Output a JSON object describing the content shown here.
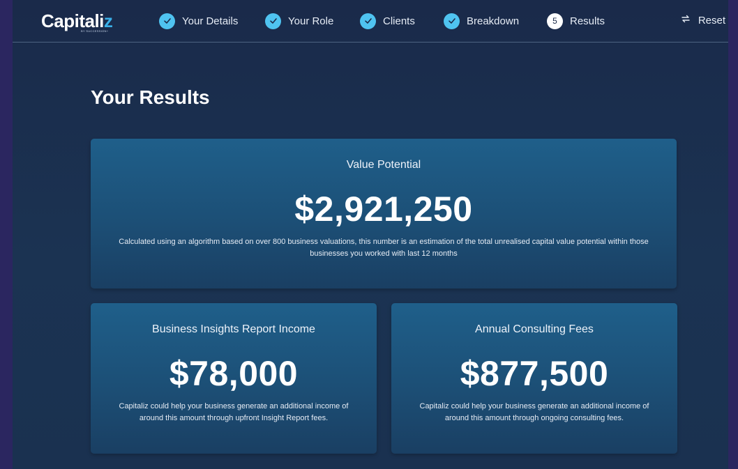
{
  "brand": {
    "name_main": "Capitali",
    "name_accent": "z",
    "tagline": "BY SUCCESSION+"
  },
  "steps": [
    {
      "label": "Your Details",
      "status": "complete",
      "icon": "check-icon"
    },
    {
      "label": "Your Role",
      "status": "complete",
      "icon": "check-icon"
    },
    {
      "label": "Clients",
      "status": "complete",
      "icon": "check-icon"
    },
    {
      "label": "Breakdown",
      "status": "complete",
      "icon": "check-icon"
    },
    {
      "label": "Results",
      "status": "current",
      "number": "5"
    }
  ],
  "reset": {
    "label": "Reset",
    "icon": "reset-icon"
  },
  "page": {
    "title": "Your Results"
  },
  "cards": {
    "value_potential": {
      "title": "Value Potential",
      "value": "$2,921,250",
      "description": "Calculated using an algorithm based on over 800 business valuations, this number is an estimation of the total unrealised capital value potential within those businesses you worked with last 12 months"
    },
    "insights_income": {
      "title": "Business Insights Report Income",
      "value": "$78,000",
      "description": "Capitaliz could help your business generate an additional income of around this amount through upfront Insight Report fees."
    },
    "consulting_fees": {
      "title": "Annual Consulting Fees",
      "value": "$877,500",
      "description": "Capitaliz could help your business generate an additional income of around this amount through ongoing consulting fees."
    }
  },
  "colors": {
    "background": "#1a2a4a",
    "outer": "#2b2660",
    "card": "#1f5f8a",
    "step_complete": "#4fc3f0",
    "logo_accent": "#3ab0e8"
  }
}
